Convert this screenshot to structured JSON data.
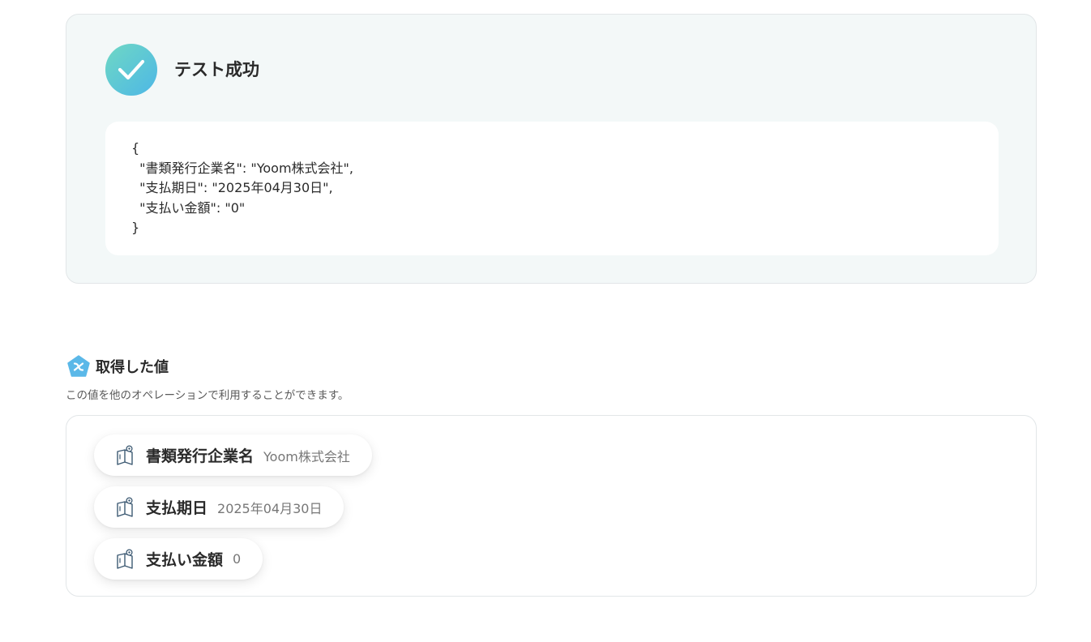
{
  "test_result": {
    "title": "テスト成功",
    "json_lines": [
      "{",
      "  \"書類発行企業名\": \"Yoom株式会社\",",
      "  \"支払期日\": \"2025年04月30日\",",
      "  \"支払い金額\": \"0\"",
      "}"
    ]
  },
  "retrieved": {
    "title": "取得した値",
    "description": "この値を他のオペレーションで利用することができます。",
    "items": [
      {
        "label": "書類発行企業名",
        "value": "Yoom株式会社"
      },
      {
        "label": "支払期日",
        "value": "2025年04月30日"
      },
      {
        "label": "支払い金額",
        "value": "0"
      }
    ]
  },
  "colors": {
    "success_gradient_start": "#6fd8c4",
    "success_gradient_end": "#4db7e6",
    "card_bg": "#f3f8f8",
    "accent_blue": "#5bb8e8"
  },
  "icons": {
    "success": "check-circle-icon",
    "section": "variable-pentagon-icon",
    "item": "book-icon"
  }
}
